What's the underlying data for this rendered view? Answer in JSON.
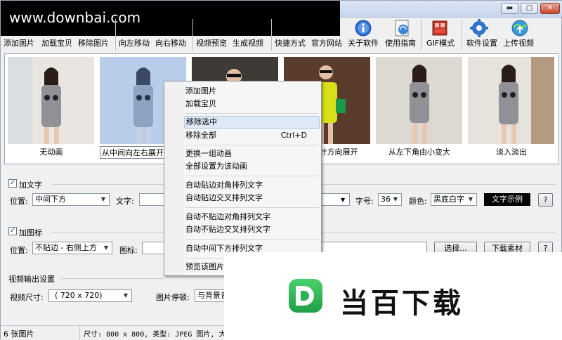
{
  "watermark": {
    "text": "www.downbai.com"
  },
  "window_controls": {
    "minimize": "▬",
    "maximize": "▢",
    "close": "✕"
  },
  "toolbar": {
    "items": [
      {
        "label": "添加图片"
      },
      {
        "label": "加载宝贝"
      },
      {
        "label": "移除图片"
      },
      {
        "label": "向左移动"
      },
      {
        "label": "向右移动"
      },
      {
        "label": "视频预览"
      },
      {
        "label": "生成视频"
      },
      {
        "label": "快捷方式"
      },
      {
        "label": "官方网站"
      },
      {
        "label": "关于软件"
      },
      {
        "label": "使用指南"
      },
      {
        "label": "GIF模式"
      },
      {
        "label": "软件设置"
      },
      {
        "label": "上传视频"
      }
    ],
    "icon_names": [
      "info-icon",
      "guide-icon",
      "gif-icon",
      "settings-gear-icon",
      "upload-globe-icon"
    ]
  },
  "thumbnails": [
    {
      "caption": "无动画"
    },
    {
      "caption": "从中间向左右展开"
    },
    {
      "caption": ""
    },
    {
      "caption": "针方向展开"
    },
    {
      "caption": "从左下角由小变大"
    },
    {
      "caption": "淡入淡出"
    }
  ],
  "text_section": {
    "enable_label": "加文字",
    "position_label": "位置:",
    "position_value": "中间下方",
    "text_label": "文字:",
    "text_value": "",
    "font_size_label": "字号:",
    "font_size_value": "36",
    "color_label": "颜色:",
    "color_value": "黑底白字",
    "sample_label": "文字示例",
    "help_label": "?"
  },
  "icon_section": {
    "enable_label": "加图标",
    "position_label": "位置:",
    "position_value": "不贴边 - 右侧上方",
    "icon_label": "图标:",
    "icon_value": "",
    "choose_label": "选择...",
    "download_label": "下载素材",
    "help_label": "?"
  },
  "video_section": {
    "title": "视频输出设置",
    "size_label": "视频尺寸:",
    "size_value": "( 720 x  720)",
    "pause_label": "图片停顿:",
    "pause_value": "与背景音"
  },
  "statusbar": {
    "count": "6 张图片",
    "info": "尺寸: 800 x 800, 类型: JPEG 图片, 大小"
  },
  "context_menu": {
    "items": [
      {
        "label": "添加图片",
        "shortcut": ""
      },
      {
        "label": "加载宝贝",
        "shortcut": ""
      },
      {
        "label": "移除选中",
        "shortcut": ""
      },
      {
        "label": "移除全部",
        "shortcut": "Ctrl+D"
      },
      {
        "label": "更换一组动画",
        "shortcut": ""
      },
      {
        "label": "全部设置为该动画",
        "shortcut": ""
      },
      {
        "label": "自动贴边对角排列文字",
        "shortcut": ""
      },
      {
        "label": "自动贴边交叉排列文字",
        "shortcut": ""
      },
      {
        "label": "自动不贴边对角排列文字",
        "shortcut": ""
      },
      {
        "label": "自动不贴边交叉排列文字",
        "shortcut": ""
      },
      {
        "label": "自动中间下方排列文字",
        "shortcut": ""
      },
      {
        "label": "预览该图片",
        "shortcut": ""
      }
    ]
  },
  "logo_overlay": {
    "text": "当百下载"
  },
  "colors": {
    "accent_green": "#2bb455",
    "menu_highlight": "#dde9f7"
  }
}
